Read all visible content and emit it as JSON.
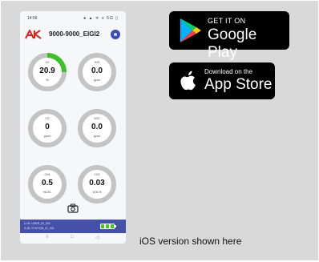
{
  "phone": {
    "status": {
      "time": "14:56",
      "icons": "● ▲ ᯤ ≡ 5G ▯"
    },
    "device_id": "9000-9000_EIGI2",
    "gauges": [
      {
        "name": "O2",
        "value": "20.9",
        "unit": "%",
        "fill": 0.25,
        "color": "#3fbf2a"
      },
      {
        "name": "H2S",
        "value": "0.0",
        "unit": "ppm",
        "fill": 0,
        "color": "#3fbf2a"
      },
      {
        "name": "CO",
        "value": "0",
        "unit": "ppm",
        "fill": 0,
        "color": "#3fbf2a"
      },
      {
        "name": "VOC",
        "value": "0.0",
        "unit": "ppm",
        "fill": 0,
        "color": "#3fbf2a"
      },
      {
        "name": "CH4",
        "value": "0.5",
        "unit": "%LEL",
        "fill": 0,
        "color": "#3fbf2a"
      },
      {
        "name": "CO2",
        "value": "0.03",
        "unit": "VOL%",
        "fill": 0,
        "color": "#3fbf2a"
      }
    ],
    "footer": {
      "user": "U-ID: USER_ID_001",
      "station": "S-ID: STATION_ID_001"
    },
    "nav": {
      "menu": "≡",
      "home": "□",
      "back": "◁"
    }
  },
  "badges": {
    "google": {
      "small": "GET IT ON",
      "big": "Google Play"
    },
    "apple": {
      "small": "Download on the",
      "big": "App Store"
    }
  },
  "caption": "iOS version shown here",
  "colors": {
    "accent_green": "#3fbf2a",
    "footer_blue": "#4550a8",
    "ring_gray": "#c4c4c4"
  }
}
